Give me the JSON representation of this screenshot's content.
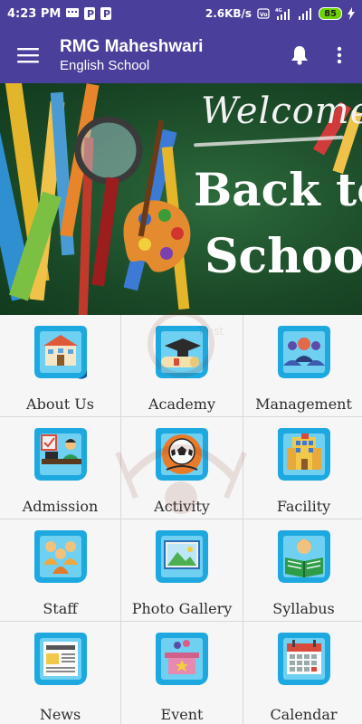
{
  "status_bar": {
    "time": "4:23 PM",
    "net_speed": "2.6KB/s",
    "network": "4G",
    "battery": "85"
  },
  "app_bar": {
    "title": "RMG Maheshwari",
    "subtitle": "English School"
  },
  "banner": {
    "welcome": "Welcome",
    "line1": "Back to",
    "line2": "School"
  },
  "watermark": {
    "line1": "Trust"
  },
  "tiles": [
    {
      "label": "About Us",
      "icon": "school-building-icon"
    },
    {
      "label": "Academy",
      "icon": "graduation-cap-icon"
    },
    {
      "label": "Management",
      "icon": "management-team-icon"
    },
    {
      "label": "Admission",
      "icon": "admission-desk-icon"
    },
    {
      "label": "Activity",
      "icon": "football-icon"
    },
    {
      "label": "Facility",
      "icon": "facility-building-icon"
    },
    {
      "label": "Staff",
      "icon": "staff-group-icon"
    },
    {
      "label": "Photo Gallery",
      "icon": "photo-gallery-icon"
    },
    {
      "label": "Syllabus",
      "icon": "reading-book-icon"
    },
    {
      "label": "News",
      "icon": "newspaper-icon"
    },
    {
      "label": "Event",
      "icon": "event-gift-icon"
    },
    {
      "label": "Calendar",
      "icon": "calendar-icon"
    }
  ],
  "colors": {
    "primary": "#4a3f9a",
    "tile_bg": "#f6f6f6",
    "icon_blue": "#1da8e0",
    "icon_dark": "#0b5aa8"
  }
}
